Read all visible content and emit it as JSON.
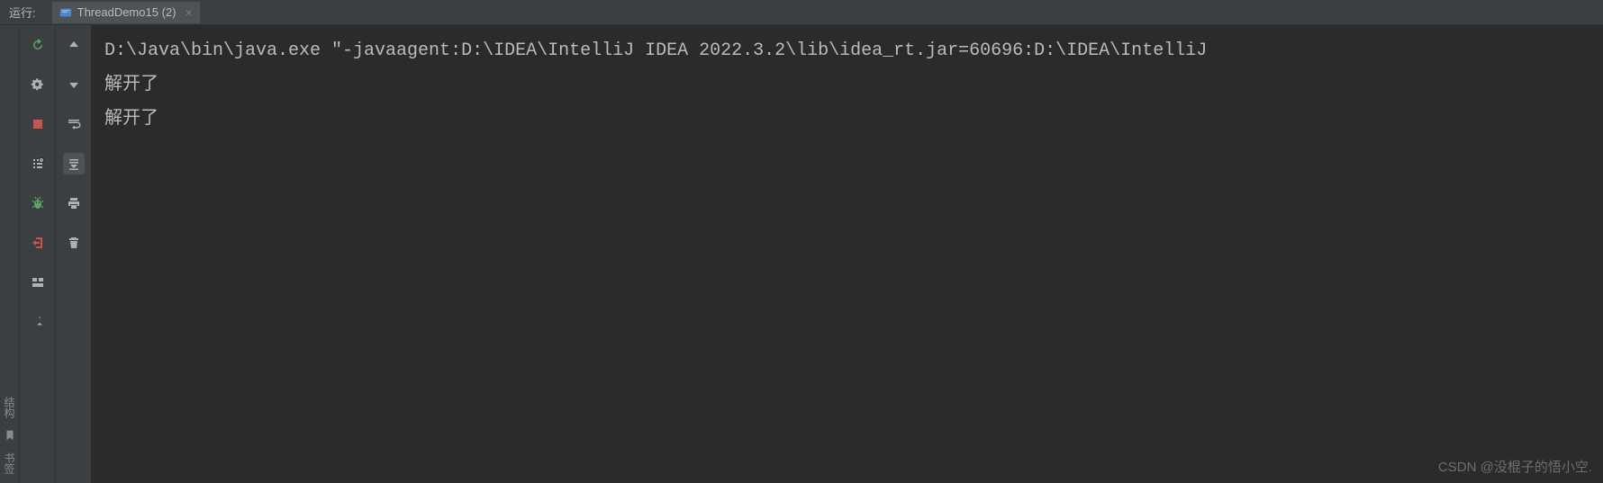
{
  "header": {
    "label": "运行:",
    "tab": {
      "title": "ThreadDemo15 (2)"
    }
  },
  "console": {
    "lines": [
      "D:\\Java\\bin\\java.exe \"-javaagent:D:\\IDEA\\IntelliJ IDEA 2022.3.2\\lib\\idea_rt.jar=60696:D:\\IDEA\\IntelliJ",
      "解开了",
      "解开了"
    ]
  },
  "side": {
    "structure": "结构",
    "bookmarks": "书签"
  },
  "watermark": "CSDN @没棍子的悟小空."
}
